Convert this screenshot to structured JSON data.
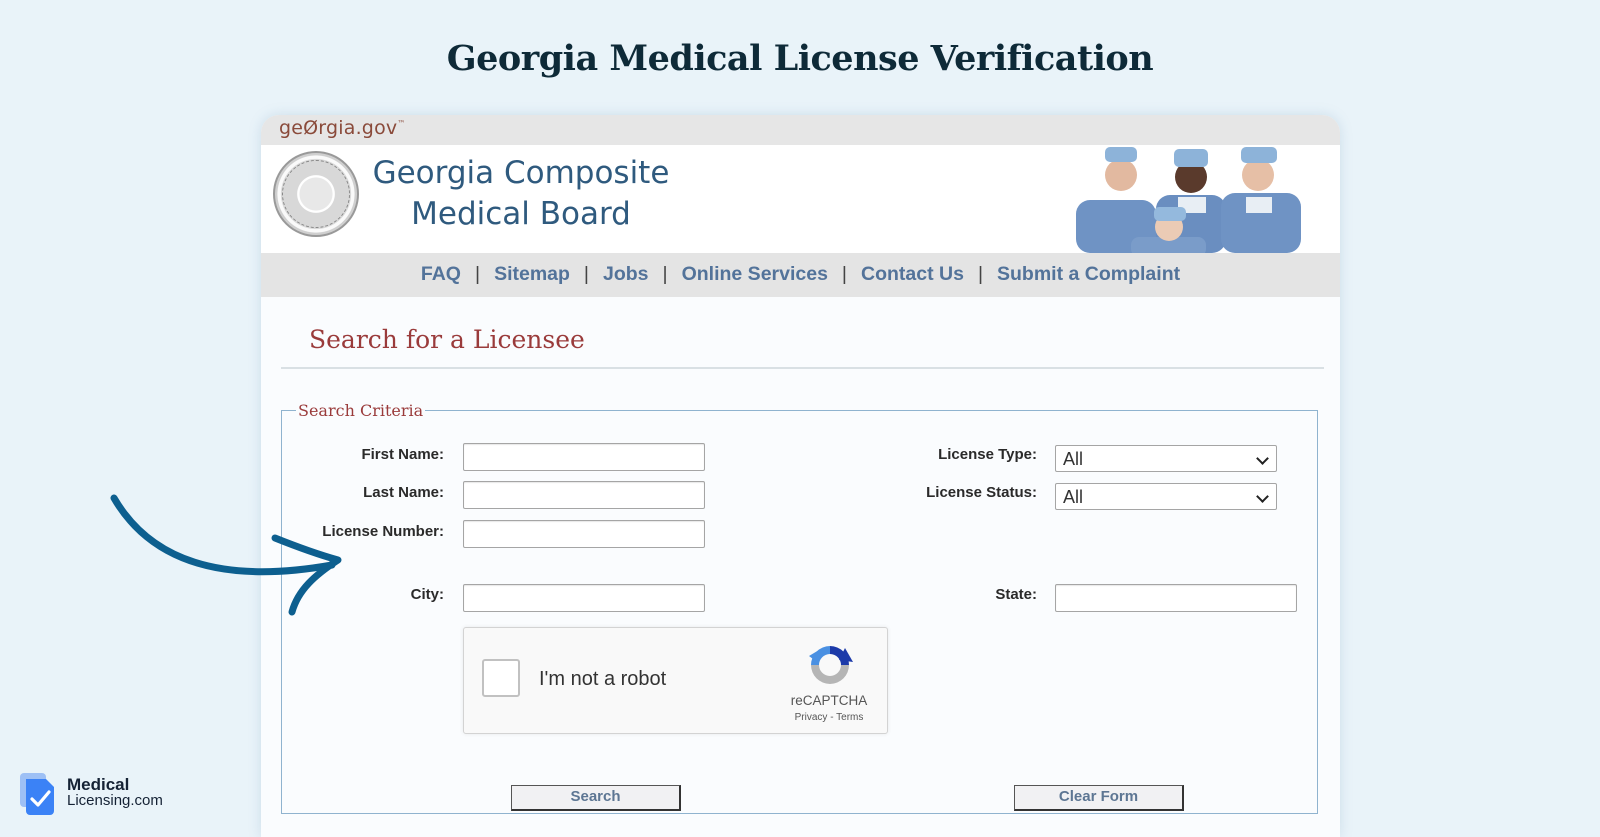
{
  "page": {
    "title": "Georgia Medical License Verification"
  },
  "site": {
    "gov_logo": "geØrgia.gov",
    "gov_logo_mark": "™",
    "board_name_line1": "Georgia Composite",
    "board_name_line2": "Medical Board"
  },
  "nav": {
    "items": [
      {
        "label": "FAQ"
      },
      {
        "label": "Sitemap"
      },
      {
        "label": "Jobs"
      },
      {
        "label": "Online Services"
      },
      {
        "label": "Contact Us"
      },
      {
        "label": "Submit a Complaint"
      }
    ],
    "separator": "|"
  },
  "search": {
    "heading": "Search for a Licensee",
    "legend": "Search Criteria",
    "fields": {
      "first_name": {
        "label": "First Name:",
        "value": ""
      },
      "last_name": {
        "label": "Last Name:",
        "value": ""
      },
      "license_number": {
        "label": "License Number:",
        "value": ""
      },
      "city": {
        "label": "City:",
        "value": ""
      },
      "state": {
        "label": "State:",
        "value": ""
      },
      "license_type": {
        "label": "License Type:",
        "selected": "All"
      },
      "license_status": {
        "label": "License Status:",
        "selected": "All"
      }
    },
    "captcha": {
      "label": "I'm not a robot",
      "brand": "reCAPTCHA",
      "privacy": "Privacy",
      "dash": " - ",
      "terms": "Terms",
      "checked": false
    },
    "buttons": {
      "search": "Search",
      "clear": "Clear Form"
    }
  },
  "branding": {
    "line1": "Medical",
    "line2": "Licensing.com"
  },
  "colors": {
    "background": "#e9f3f9",
    "nav_link": "#53739a",
    "heading_red": "#9a3b3b",
    "arrow": "#0d5f8f",
    "brand_blue": "#3b82f6"
  }
}
